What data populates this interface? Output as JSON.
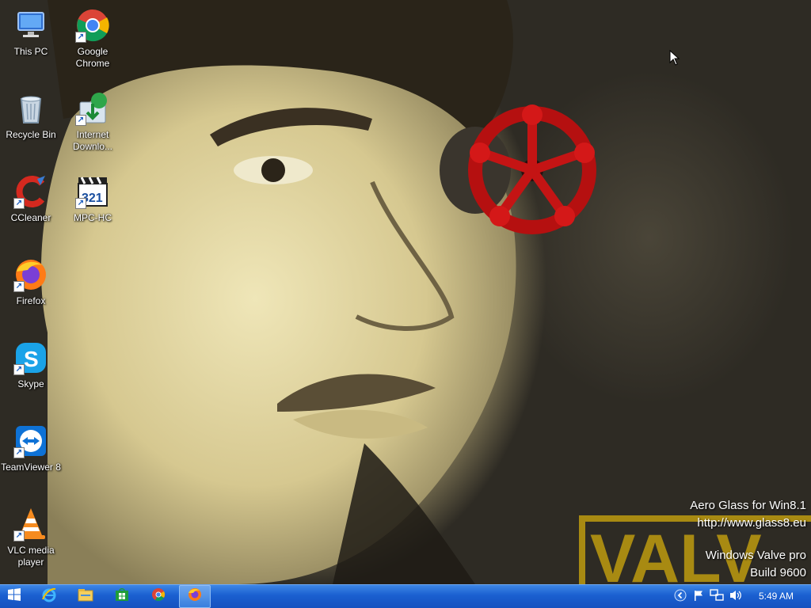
{
  "desktop": {
    "icons": [
      {
        "label": "This PC",
        "icon": "computer-icon"
      },
      {
        "label": "Google Chrome",
        "icon": "chrome-icon"
      },
      {
        "label": "Recycle Bin",
        "icon": "recycle-bin-icon"
      },
      {
        "label": "Internet Downlo...",
        "icon": "internet-download-manager-icon"
      },
      {
        "label": "CCleaner",
        "icon": "ccleaner-icon"
      },
      {
        "label": "MPC-HC",
        "icon": "mpc-hc-icon"
      },
      {
        "label": "Firefox",
        "icon": "firefox-icon"
      },
      {
        "label": "Skype",
        "icon": "skype-icon"
      },
      {
        "label": "TeamViewer 8",
        "icon": "teamviewer-icon"
      },
      {
        "label": "VLC media player",
        "icon": "vlc-icon"
      }
    ],
    "wallpaper_text": "VALV"
  },
  "watermark": {
    "line1": "Aero Glass for Win8.1",
    "line2": "http://www.glass8.eu",
    "line3": "Windows Valve pro",
    "line4": "Build 9600"
  },
  "taskbar": {
    "start_icon": "windows-start-icon",
    "pinned": [
      "internet-explorer-icon",
      "file-explorer-icon",
      "store-icon",
      "chrome-icon",
      "firefox-icon"
    ],
    "active_app": "firefox-icon",
    "tray_icons": [
      "show-hidden-icons-icon",
      "action-center-flag-icon",
      "network-icon",
      "volume-icon"
    ],
    "clock": "5:49 AM",
    "color": "#1a5fd0"
  }
}
